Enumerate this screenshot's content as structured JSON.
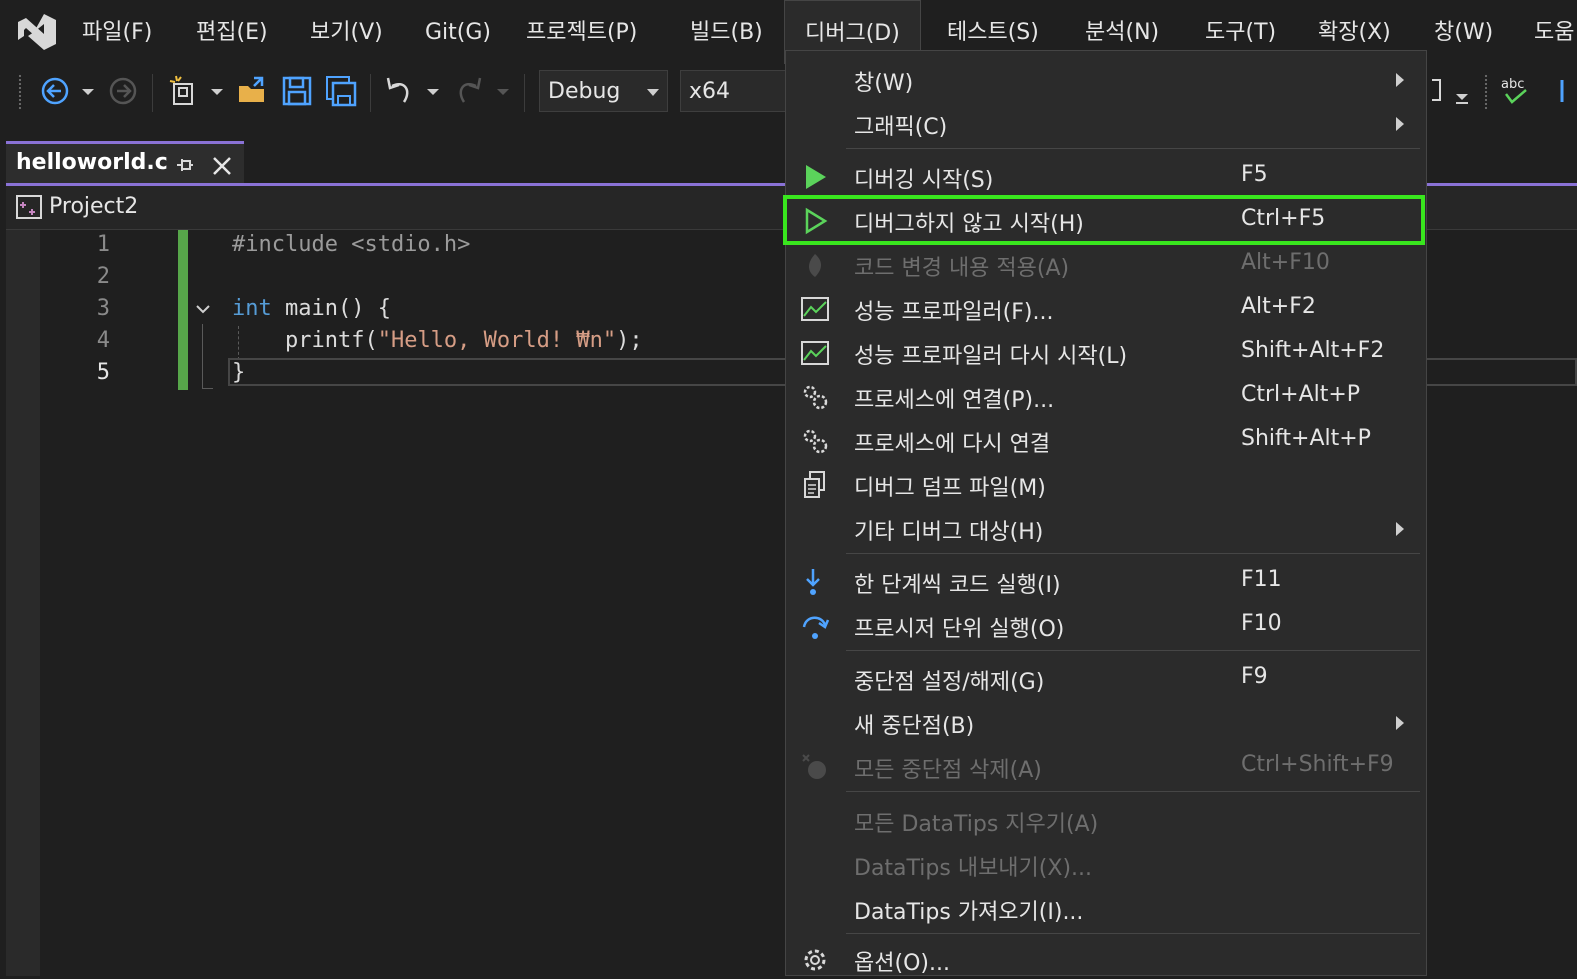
{
  "menubar": {
    "items": [
      "파일(F)",
      "편집(E)",
      "보기(V)",
      "Git(G)",
      "프로젝트(P)",
      "빌드(B)",
      "디버그(D)",
      "테스트(S)",
      "분석(N)",
      "도구(T)",
      "확장(X)",
      "창(W)",
      "도움"
    ],
    "active": "디버그(D)"
  },
  "toolbar": {
    "configuration": "Debug",
    "platform": "x64",
    "icons": [
      "back-icon",
      "forward-icon",
      "new-item-icon",
      "open-folder-icon",
      "save-icon",
      "save-all-icon",
      "undo-icon",
      "redo-icon",
      "spell-check-icon"
    ]
  },
  "tab": {
    "title": "helloworld.c"
  },
  "navbar": {
    "project": "Project2"
  },
  "editor": {
    "line_numbers": [
      "1",
      "2",
      "3",
      "4",
      "5"
    ],
    "current_line": "5",
    "code": {
      "l1": "#include <stdio.h>",
      "l3_kw": "int",
      "l3_rest": " main() {",
      "l4_fn": "    printf(",
      "l4_str": "\"Hello, World! ₩n\"",
      "l4_end": ");",
      "l5": "}"
    }
  },
  "debug_menu": {
    "items": [
      {
        "label": "창(W)",
        "shortcut": "",
        "submenu": true,
        "icon": ""
      },
      {
        "label": "그래픽(C)",
        "shortcut": "",
        "submenu": true,
        "icon": ""
      },
      {
        "label": "디버깅 시작(S)",
        "shortcut": "F5",
        "icon": "play-filled-icon"
      },
      {
        "label": "디버그하지 않고 시작(H)",
        "shortcut": "Ctrl+F5",
        "icon": "play-outline-icon",
        "highlighted": true
      },
      {
        "label": "코드 변경 내용 적용(A)",
        "shortcut": "Alt+F10",
        "icon": "hot-reload-icon",
        "disabled": true
      },
      {
        "label": "성능 프로파일러(F)...",
        "shortcut": "Alt+F2",
        "icon": "profiler-icon"
      },
      {
        "label": "성능 프로파일러 다시 시작(L)",
        "shortcut": "Shift+Alt+F2",
        "icon": "profiler-icon"
      },
      {
        "label": "프로세스에 연결(P)...",
        "shortcut": "Ctrl+Alt+P",
        "icon": "gears-icon"
      },
      {
        "label": "프로세스에 다시 연결",
        "shortcut": "Shift+Alt+P",
        "icon": "gears-icon"
      },
      {
        "label": "디버그 덤프 파일(M)",
        "shortcut": "",
        "icon": "dump-file-icon"
      },
      {
        "label": "기타 디버그 대상(H)",
        "shortcut": "",
        "submenu": true,
        "icon": ""
      },
      {
        "label": "한 단계씩 코드 실행(I)",
        "shortcut": "F11",
        "icon": "step-into-icon"
      },
      {
        "label": "프로시저 단위 실행(O)",
        "shortcut": "F10",
        "icon": "step-over-icon"
      },
      {
        "label": "중단점 설정/해제(G)",
        "shortcut": "F9",
        "icon": ""
      },
      {
        "label": "새 중단점(B)",
        "shortcut": "",
        "submenu": true,
        "icon": ""
      },
      {
        "label": "모든 중단점 삭제(A)",
        "shortcut": "Ctrl+Shift+F9",
        "icon": "delete-breakpoints-icon",
        "disabled": true
      },
      {
        "label": "모든 DataTips 지우기(A)",
        "shortcut": "",
        "icon": "",
        "disabled": true
      },
      {
        "label": "DataTips 내보내기(X)...",
        "shortcut": "",
        "icon": "",
        "disabled": true
      },
      {
        "label": "DataTips 가져오기(I)...",
        "shortcut": "",
        "icon": ""
      },
      {
        "label": "옵션(O)...",
        "shortcut": "",
        "icon": "gear-icon"
      }
    ]
  },
  "colors": {
    "accent": "#8a72d6",
    "highlight_outline": "#39e61e",
    "play_green": "#5bd35b",
    "change_bar": "#57a64a"
  }
}
